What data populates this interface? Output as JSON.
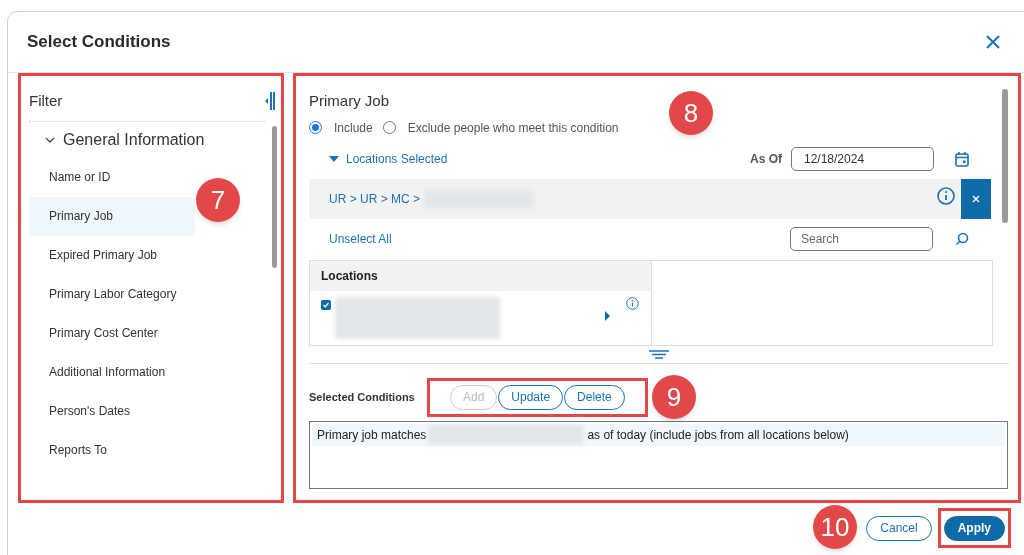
{
  "dialog": {
    "title": "Select Conditions"
  },
  "filter": {
    "title": "Filter",
    "group": {
      "label": "General Information",
      "expanded": true,
      "children": [
        {
          "label": "Name or ID",
          "selected": false
        },
        {
          "label": "Primary Job",
          "selected": true
        },
        {
          "label": "Expired Primary Job",
          "selected": false
        },
        {
          "label": "Primary Labor Category",
          "selected": false
        },
        {
          "label": "Primary Cost Center",
          "selected": false
        },
        {
          "label": "Additional Information",
          "selected": false
        },
        {
          "label": "Person's Dates",
          "selected": false
        },
        {
          "label": "Reports To",
          "selected": false
        }
      ]
    }
  },
  "condition": {
    "title": "Primary Job",
    "options": [
      {
        "label": "Include",
        "selected": true
      },
      {
        "label": "Exclude people who meet this condition",
        "selected": false
      }
    ],
    "locations_toggle": {
      "label": "Locations Selected",
      "expanded": true
    },
    "as_of": {
      "label": "As Of",
      "value": "12/18/2024"
    },
    "path": "UR > UR > MC >",
    "unselect_all": "Unselect All",
    "search": {
      "placeholder": "Search"
    },
    "locations": {
      "heading": "Locations",
      "rows": [
        {
          "checked": true
        }
      ]
    }
  },
  "selected_conditions": {
    "label": "Selected Conditions",
    "buttons": [
      {
        "label": "Add",
        "disabled": true
      },
      {
        "label": "Update",
        "disabled": false
      },
      {
        "label": "Delete",
        "disabled": false
      }
    ],
    "items": [
      {
        "prefix": "Primary job matches",
        "suffix": "as of today (include jobs from all locations below)"
      }
    ]
  },
  "footer": {
    "buttons": [
      {
        "label": "Cancel",
        "kind": "secondary"
      },
      {
        "label": "Apply",
        "kind": "primary"
      }
    ]
  },
  "callouts": [
    "7",
    "8",
    "9",
    "10"
  ]
}
